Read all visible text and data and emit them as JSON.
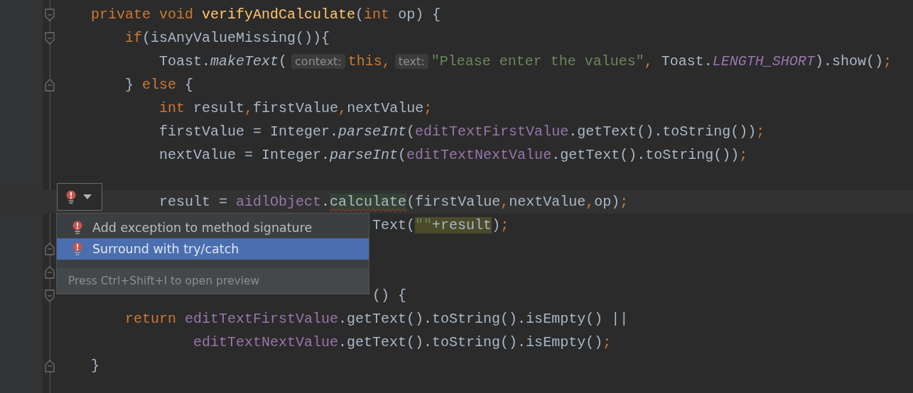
{
  "editor": {
    "lines": [
      {
        "fold_start": true,
        "fold_end": false,
        "tokens": [
          {
            "kind": "kw",
            "text": "private void "
          },
          {
            "kind": "decl",
            "text": "verifyAndCalculate"
          },
          {
            "kind": "plain",
            "text": "("
          },
          {
            "kind": "kw",
            "text": "int"
          },
          {
            "kind": "plain",
            "text": " op) {"
          }
        ]
      },
      {
        "fold_start": true,
        "fold_end": false,
        "tokens": [
          {
            "kind": "kw",
            "text": "    if"
          },
          {
            "kind": "plain",
            "text": "(isAnyValueMissing()){"
          }
        ]
      },
      {
        "fold_start": false,
        "fold_end": false,
        "tokens": [
          {
            "kind": "plain",
            "text": "        Toast."
          },
          {
            "kind": "static",
            "text": "makeText"
          },
          {
            "kind": "plain",
            "text": "("
          },
          {
            "kind": "hint",
            "text": "context:"
          },
          {
            "kind": "kw",
            "text": "this,"
          },
          {
            "kind": "hint",
            "text": "text:"
          },
          {
            "kind": "str",
            "text": "\"Please enter the values\""
          },
          {
            "kind": "punct",
            "text": ", "
          },
          {
            "kind": "plain",
            "text": "Toast."
          },
          {
            "kind": "const",
            "text": "LENGTH_SHORT"
          },
          {
            "kind": "plain",
            "text": ").show()"
          },
          {
            "kind": "punct",
            "text": ";"
          }
        ]
      },
      {
        "fold_start": false,
        "fold_end": true,
        "tokens": [
          {
            "kind": "plain",
            "text": "    } "
          },
          {
            "kind": "kw",
            "text": "else"
          },
          {
            "kind": "plain",
            "text": " {"
          }
        ]
      },
      {
        "fold_start": false,
        "fold_end": false,
        "tokens": [
          {
            "kind": "kw",
            "text": "        int"
          },
          {
            "kind": "plain",
            "text": " result"
          },
          {
            "kind": "punct",
            "text": ","
          },
          {
            "kind": "plain",
            "text": "firstValue"
          },
          {
            "kind": "punct",
            "text": ","
          },
          {
            "kind": "plain",
            "text": "nextValue"
          },
          {
            "kind": "punct",
            "text": ";"
          }
        ]
      },
      {
        "fold_start": false,
        "fold_end": false,
        "tokens": [
          {
            "kind": "plain",
            "text": "        firstValue = Integer."
          },
          {
            "kind": "static",
            "text": "parseInt"
          },
          {
            "kind": "plain",
            "text": "("
          },
          {
            "kind": "field",
            "text": "editTextFirstValue"
          },
          {
            "kind": "plain",
            "text": ".getText().toString())"
          },
          {
            "kind": "punct",
            "text": ";"
          }
        ]
      },
      {
        "fold_start": false,
        "fold_end": false,
        "tokens": [
          {
            "kind": "plain",
            "text": "        nextValue = Integer."
          },
          {
            "kind": "static",
            "text": "parseInt"
          },
          {
            "kind": "plain",
            "text": "("
          },
          {
            "kind": "field",
            "text": "editTextNextValue"
          },
          {
            "kind": "plain",
            "text": ".getText().toString())"
          },
          {
            "kind": "punct",
            "text": ";"
          }
        ]
      },
      {
        "fold_start": false,
        "fold_end": false
      },
      {
        "fold_start": false,
        "fold_end": false,
        "current": true,
        "tokens": [
          {
            "kind": "plain",
            "text": "        result = "
          },
          {
            "kind": "field",
            "text": "aidlObject"
          },
          {
            "kind": "plain",
            "text": "."
          },
          {
            "kind": "plain",
            "text": "calculate",
            "error": true
          },
          {
            "kind": "plain",
            "text": "(firstValue"
          },
          {
            "kind": "punct",
            "text": ","
          },
          {
            "kind": "plain",
            "text": "nextValue"
          },
          {
            "kind": "punct",
            "text": ","
          },
          {
            "kind": "plain",
            "text": "op)"
          },
          {
            "kind": "punct",
            "text": ";"
          }
        ]
      },
      {
        "fold_start": false,
        "fold_end": false,
        "tokens": [
          {
            "kind": "plain",
            "text": "                                 Text("
          },
          {
            "kind": "str",
            "text": "\"\"",
            "highlighted": true
          },
          {
            "kind": "plain",
            "text": "+result",
            "highlighted": true
          },
          {
            "kind": "plain",
            "text": ")"
          },
          {
            "kind": "punct",
            "text": ";"
          }
        ]
      },
      {
        "fold_start": false,
        "fold_end": true
      },
      {
        "fold_start": false,
        "fold_end": true
      },
      {
        "fold_start": true,
        "fold_end": false,
        "tokens": [
          {
            "kind": "plain",
            "text": "                                 () {"
          }
        ]
      },
      {
        "fold_start": false,
        "fold_end": false,
        "tokens": [
          {
            "kind": "kw",
            "text": "    return "
          },
          {
            "kind": "field",
            "text": "editTextFirstValue"
          },
          {
            "kind": "plain",
            "text": ".getText().toString().isEmpty() ||"
          }
        ]
      },
      {
        "fold_start": false,
        "fold_end": false,
        "tokens": [
          {
            "kind": "field",
            "text": "            editTextNextValue"
          },
          {
            "kind": "plain",
            "text": ".getText().toString().isEmpty()"
          },
          {
            "kind": "punct",
            "text": ";"
          }
        ]
      },
      {
        "fold_start": false,
        "fold_end": true,
        "tokens": [
          {
            "kind": "plain",
            "text": "}"
          }
        ]
      }
    ]
  },
  "intention_popup": {
    "items": [
      {
        "label": "Add exception to method signature",
        "selected": false
      },
      {
        "label": "Surround with try/catch",
        "selected": true
      }
    ],
    "footer": "Press Ctrl+Shift+I to open preview"
  }
}
